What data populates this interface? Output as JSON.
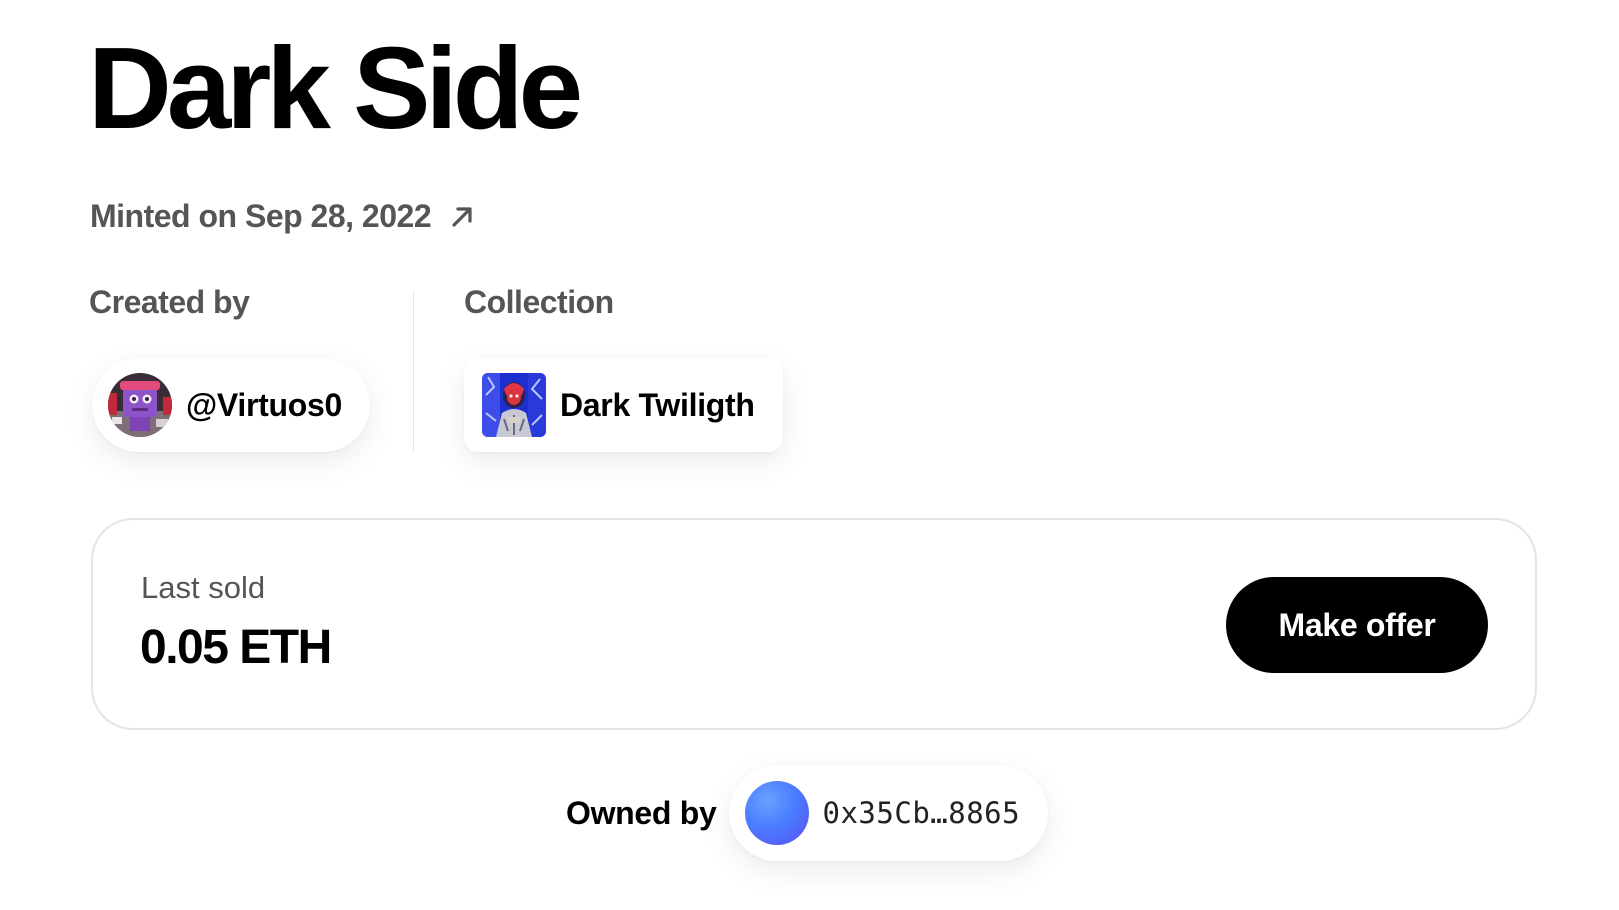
{
  "artwork": {
    "title": "Dark Side",
    "minted_text": "Minted on Sep 28, 2022"
  },
  "creator": {
    "label": "Created by",
    "handle": "@Virtuos0"
  },
  "collection": {
    "label": "Collection",
    "name": "Dark Twiligth"
  },
  "sale": {
    "label": "Last sold",
    "value": "0.05 ETH",
    "button_label": "Make offer"
  },
  "owner": {
    "label": "Owned by",
    "address": "0x35Cb…8865"
  },
  "icons": {
    "minted_link": "arrow-up-right-icon",
    "creator_avatar": "creator-avatar-image",
    "collection_thumbnail": "collection-thumbnail-image",
    "owner_avatar": "owner-gradient-avatar"
  },
  "colors": {
    "text_primary": "#000000",
    "text_secondary": "#555555",
    "button_bg": "#000000",
    "button_text": "#ffffff",
    "card_border": "#e4e4e4",
    "owner_avatar_blue": "#4a7dff"
  }
}
